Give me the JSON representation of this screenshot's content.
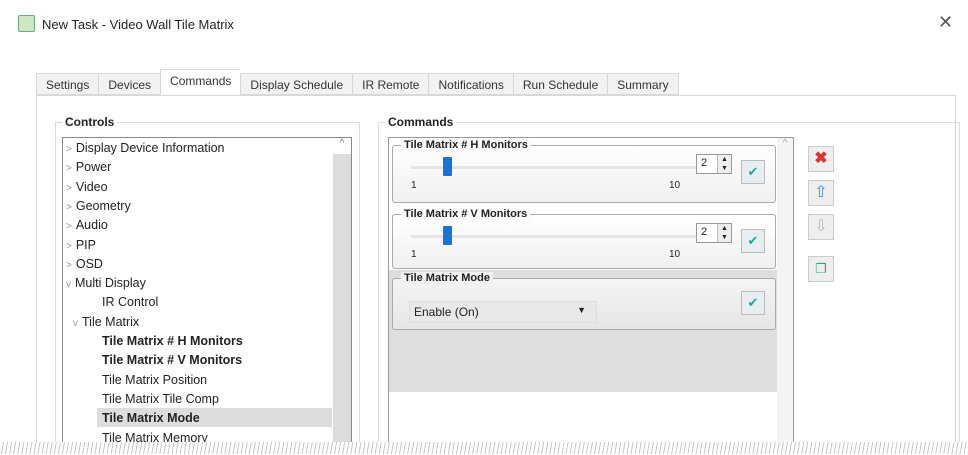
{
  "window": {
    "title": "New Task - Video Wall Tile Matrix",
    "close": "✕"
  },
  "tabs": [
    "Settings",
    "Devices",
    "Commands",
    "Display Schedule",
    "IR Remote",
    "Notifications",
    "Run Schedule",
    "Summary"
  ],
  "controls": {
    "label": "Controls",
    "items": [
      {
        "label": "Display Device Information",
        "arrow": ">"
      },
      {
        "label": "Power",
        "arrow": ">"
      },
      {
        "label": "Video",
        "arrow": ">"
      },
      {
        "label": "Geometry",
        "arrow": ">"
      },
      {
        "label": "Audio",
        "arrow": ">"
      },
      {
        "label": "PIP",
        "arrow": ">"
      },
      {
        "label": "OSD",
        "arrow": ">"
      },
      {
        "label": "Multi Display",
        "arrow": "v"
      },
      {
        "label": "IR Control"
      },
      {
        "label": "Tile Matrix",
        "arrow": "v"
      },
      {
        "label": "Tile Matrix # H Monitors"
      },
      {
        "label": "Tile Matrix # V Monitors"
      },
      {
        "label": "Tile Matrix Position"
      },
      {
        "label": "Tile Matrix Tile Comp"
      },
      {
        "label": "Tile Matrix Mode"
      },
      {
        "label": "Tile Matrix Memory"
      }
    ]
  },
  "commands": {
    "label": "Commands",
    "h": {
      "title": "Tile Matrix # H Monitors",
      "min": "1",
      "max": "10",
      "value": "2"
    },
    "v": {
      "title": "Tile Matrix # V Monitors",
      "min": "1",
      "max": "10",
      "value": "2"
    },
    "mode": {
      "title": "Tile Matrix Mode",
      "selected": "Enable (On)"
    }
  }
}
